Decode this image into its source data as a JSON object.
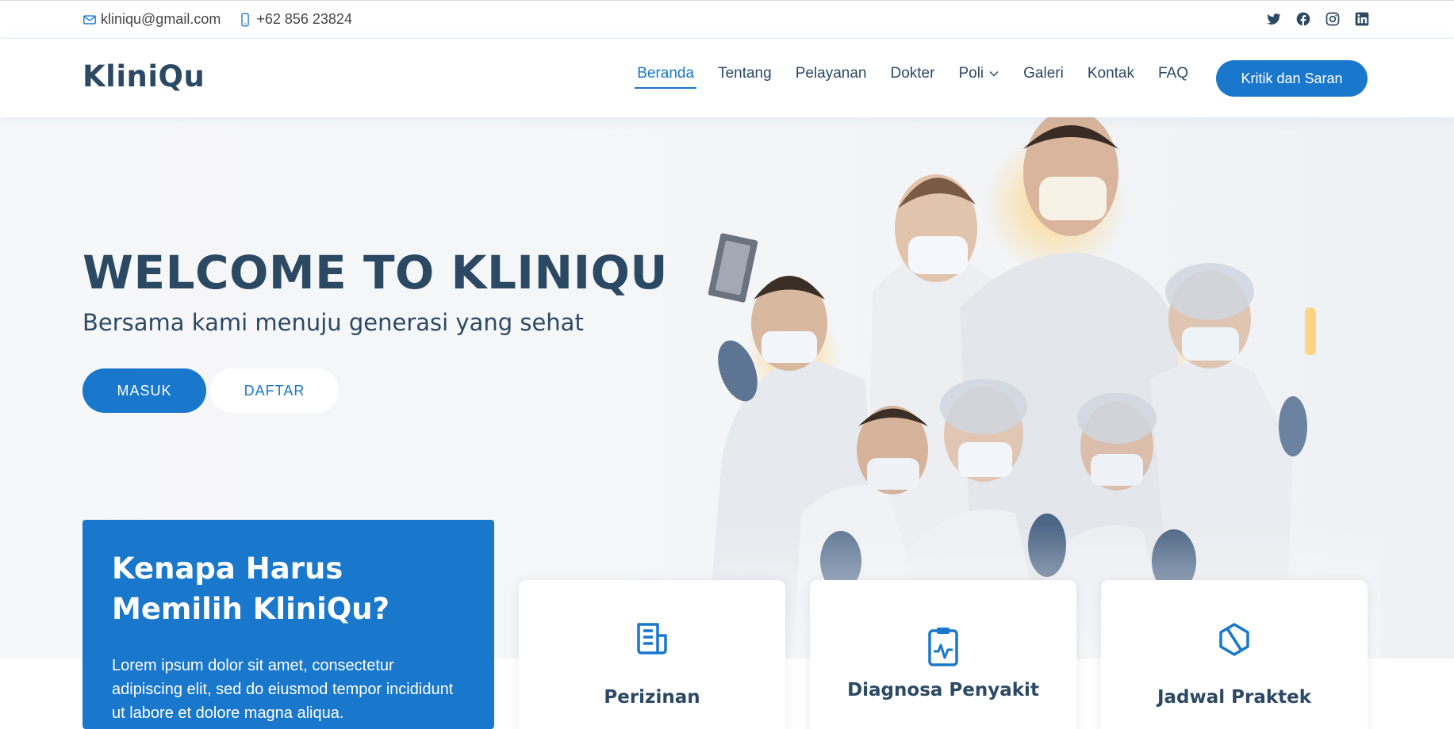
{
  "topbar": {
    "email": "kliniqu@gmail.com",
    "phone": "+62 856 23824",
    "social_icons": [
      "twitter-icon",
      "facebook-icon",
      "instagram-icon",
      "linkedin-icon"
    ]
  },
  "header": {
    "logo": "KliniQu",
    "nav": [
      {
        "label": "Beranda",
        "active": true
      },
      {
        "label": "Tentang"
      },
      {
        "label": "Pelayanan"
      },
      {
        "label": "Dokter"
      },
      {
        "label": "Poli",
        "dropdown": true
      },
      {
        "label": "Galeri"
      },
      {
        "label": "Kontak"
      },
      {
        "label": "FAQ"
      }
    ],
    "cta": "Kritik dan Saran"
  },
  "hero": {
    "title": "WELCOME TO KLINIQU",
    "subtitle": "Bersama kami menuju generasi yang sehat",
    "btn_masuk": "MASUK",
    "btn_daftar": "DAFTAR"
  },
  "why": {
    "title_line1": "Kenapa Harus",
    "title_line2": "Memilih KliniQu?",
    "text": "Lorem ipsum dolor sit amet, consectetur adipiscing elit, sed do eiusmod tempor incididunt ut labore et dolore magna aliqua."
  },
  "cards": [
    {
      "icon": "document-icon",
      "title": "Perizinan"
    },
    {
      "icon": "clipboard-pulse-icon",
      "title": "Diagnosa Penyakit"
    },
    {
      "icon": "cube-icon",
      "title": "Jadwal Praktek"
    }
  ],
  "colors": {
    "accent": "#1977cc",
    "heading": "#2c4964",
    "hero_bg": "#f5f6f8"
  }
}
